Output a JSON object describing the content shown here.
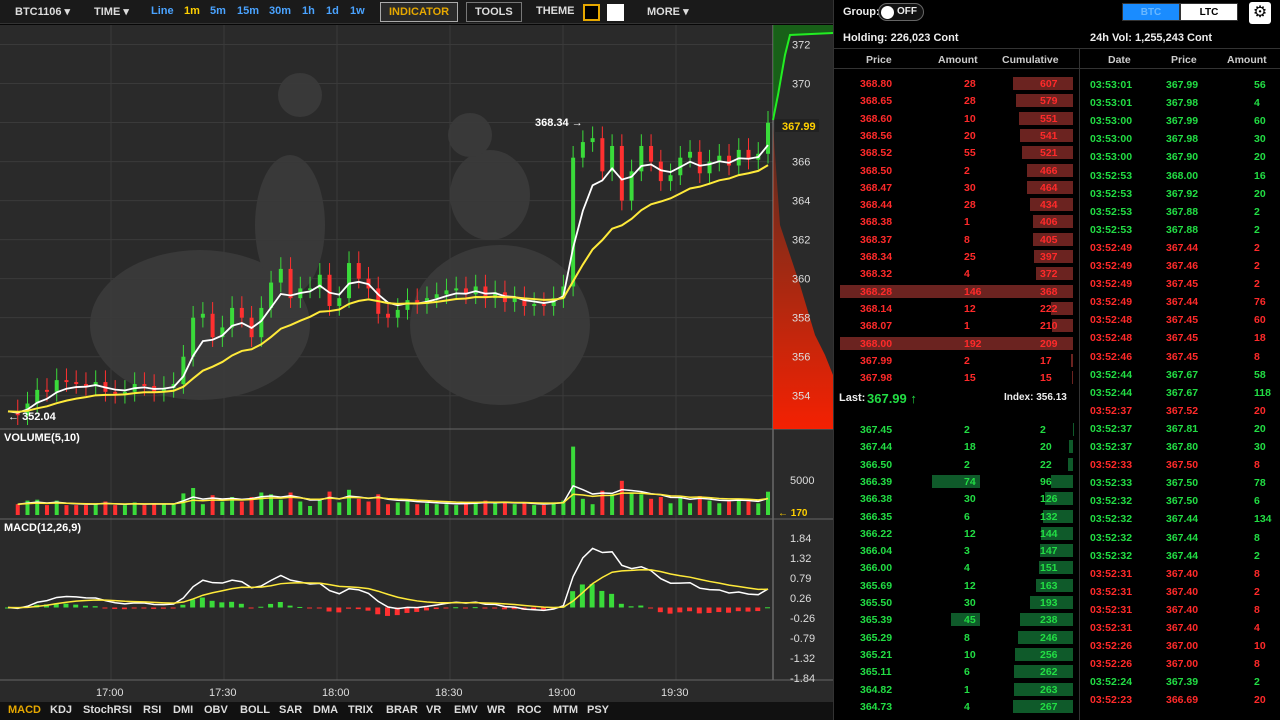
{
  "toolbar": {
    "symbol": "BTC1106",
    "time_label": "TIME",
    "intervals": [
      "Line",
      "1m",
      "5m",
      "15m",
      "30m",
      "1h",
      "1d",
      "1w"
    ],
    "selected_interval": "1m",
    "indicator_label": "INDICATOR",
    "tools_label": "TOOLS",
    "theme_label": "THEME",
    "more_label": "MORE"
  },
  "bottom_indicators": [
    "MACD",
    "KDJ",
    "StochRSI",
    "RSI",
    "DMI",
    "OBV",
    "BOLL",
    "SAR",
    "DMA",
    "TRIX",
    "BRAR",
    "VR",
    "EMV",
    "WR",
    "ROC",
    "MTM",
    "PSY"
  ],
  "selected_indicator": "MACD",
  "chart_data": {
    "type": "line",
    "x_labels": [
      "17:00",
      "17:30",
      "18:00",
      "18:30",
      "19:00",
      "19:30"
    ],
    "price_ticks": [
      "372",
      "370",
      "368",
      "366",
      "364",
      "362",
      "360",
      "358",
      "356",
      "354"
    ],
    "price_range": [
      352.5,
      373
    ],
    "price_series": [
      353.2,
      353.0,
      353.6,
      354.3,
      354.2,
      354.8,
      354.7,
      354.6,
      354.5,
      354.7,
      354.2,
      354.1,
      354.2,
      354.6,
      354.5,
      354.2,
      354.4,
      354.6,
      356.0,
      358.0,
      358.2,
      357.0,
      357.5,
      358.5,
      358.0,
      357.0,
      358.5,
      359.8,
      360.5,
      359.0,
      359.5,
      359.5,
      360.2,
      358.6,
      359.0,
      360.8,
      360.0,
      359.5,
      358.2,
      358.0,
      358.4,
      358.9,
      358.7,
      359.0,
      359.2,
      359.4,
      359.5,
      359.2,
      359.6,
      359.0,
      359.3,
      358.8,
      359.0,
      358.6,
      358.7,
      358.6,
      359.0,
      359.6,
      366.2,
      367.0,
      367.2,
      365.5,
      366.8,
      364.0,
      365.5,
      366.8,
      366.0,
      365.0,
      365.3,
      366.2,
      366.5,
      365.4,
      366.0,
      366.3,
      365.8,
      366.6,
      366.1,
      366.4,
      367.99
    ],
    "annotations": {
      "high": "368.34",
      "low": "352.04",
      "last": "367.99"
    },
    "volume_label": "VOLUME(5,10)",
    "volume_ticks": [
      "5000"
    ],
    "volume_last": "170",
    "macd_label": "MACD(12,26,9)",
    "macd_ticks": [
      "1.84",
      "1.32",
      "0.79",
      "0.26",
      "-0.26",
      "-0.79",
      "-1.32",
      "-1.84"
    ]
  },
  "right_panel": {
    "group_label": "Group:",
    "group_toggle": "OFF",
    "pair_btc": "BTC",
    "pair_ltc": "LTC",
    "holding": "Holding: 226,023 Cont",
    "volume_24h": "24h Vol: 1,255,243 Cont",
    "book_headers": [
      "Price",
      "Amount",
      "Cumulative"
    ],
    "trade_headers": [
      "Date",
      "Price",
      "Amount"
    ],
    "asks": [
      [
        "368.80",
        "28",
        "607"
      ],
      [
        "368.65",
        "28",
        "579"
      ],
      [
        "368.60",
        "10",
        "551"
      ],
      [
        "368.56",
        "20",
        "541"
      ],
      [
        "368.52",
        "55",
        "521"
      ],
      [
        "368.50",
        "2",
        "466"
      ],
      [
        "368.47",
        "30",
        "464"
      ],
      [
        "368.44",
        "28",
        "434"
      ],
      [
        "368.38",
        "1",
        "406"
      ],
      [
        "368.37",
        "8",
        "405"
      ],
      [
        "368.34",
        "25",
        "397"
      ],
      [
        "368.32",
        "4",
        "372"
      ],
      [
        "368.28",
        "146",
        "368"
      ],
      [
        "368.14",
        "12",
        "222"
      ],
      [
        "368.07",
        "1",
        "210"
      ],
      [
        "368.00",
        "192",
        "209"
      ],
      [
        "367.99",
        "2",
        "17"
      ],
      [
        "367.98",
        "15",
        "15"
      ]
    ],
    "last_label": "Last:",
    "last_price": "367.99",
    "index_label": "Index: 356.13",
    "bids": [
      [
        "367.45",
        "2",
        "2"
      ],
      [
        "367.44",
        "18",
        "20"
      ],
      [
        "366.50",
        "2",
        "22"
      ],
      [
        "366.39",
        "74",
        "96"
      ],
      [
        "366.38",
        "30",
        "126"
      ],
      [
        "366.35",
        "6",
        "132"
      ],
      [
        "366.22",
        "12",
        "144"
      ],
      [
        "366.04",
        "3",
        "147"
      ],
      [
        "366.00",
        "4",
        "151"
      ],
      [
        "365.69",
        "12",
        "163"
      ],
      [
        "365.50",
        "30",
        "193"
      ],
      [
        "365.39",
        "45",
        "238"
      ],
      [
        "365.29",
        "8",
        "246"
      ],
      [
        "365.21",
        "10",
        "256"
      ],
      [
        "365.11",
        "6",
        "262"
      ],
      [
        "364.82",
        "1",
        "263"
      ],
      [
        "364.73",
        "4",
        "267"
      ]
    ],
    "trades": [
      [
        "03:53:01",
        "367.99",
        "56",
        "g"
      ],
      [
        "03:53:01",
        "367.98",
        "4",
        "g"
      ],
      [
        "03:53:00",
        "367.99",
        "60",
        "g"
      ],
      [
        "03:53:00",
        "367.98",
        "30",
        "g"
      ],
      [
        "03:53:00",
        "367.90",
        "20",
        "g"
      ],
      [
        "03:52:53",
        "368.00",
        "16",
        "g"
      ],
      [
        "03:52:53",
        "367.92",
        "20",
        "g"
      ],
      [
        "03:52:53",
        "367.88",
        "2",
        "g"
      ],
      [
        "03:52:53",
        "367.88",
        "2",
        "g"
      ],
      [
        "03:52:49",
        "367.44",
        "2",
        "r"
      ],
      [
        "03:52:49",
        "367.46",
        "2",
        "r"
      ],
      [
        "03:52:49",
        "367.45",
        "2",
        "r"
      ],
      [
        "03:52:49",
        "367.44",
        "76",
        "r"
      ],
      [
        "03:52:48",
        "367.45",
        "60",
        "r"
      ],
      [
        "03:52:48",
        "367.45",
        "18",
        "r"
      ],
      [
        "03:52:46",
        "367.45",
        "8",
        "r"
      ],
      [
        "03:52:44",
        "367.67",
        "58",
        "g"
      ],
      [
        "03:52:44",
        "367.67",
        "118",
        "g"
      ],
      [
        "03:52:37",
        "367.52",
        "20",
        "r"
      ],
      [
        "03:52:37",
        "367.81",
        "20",
        "g"
      ],
      [
        "03:52:37",
        "367.80",
        "30",
        "g"
      ],
      [
        "03:52:33",
        "367.50",
        "8",
        "r"
      ],
      [
        "03:52:33",
        "367.50",
        "78",
        "g"
      ],
      [
        "03:52:32",
        "367.50",
        "6",
        "g"
      ],
      [
        "03:52:32",
        "367.44",
        "134",
        "g"
      ],
      [
        "03:52:32",
        "367.44",
        "8",
        "g"
      ],
      [
        "03:52:32",
        "367.44",
        "2",
        "g"
      ],
      [
        "03:52:31",
        "367.40",
        "8",
        "r"
      ],
      [
        "03:52:31",
        "367.40",
        "2",
        "r"
      ],
      [
        "03:52:31",
        "367.40",
        "8",
        "r"
      ],
      [
        "03:52:31",
        "367.40",
        "4",
        "r"
      ],
      [
        "03:52:26",
        "367.00",
        "10",
        "r"
      ],
      [
        "03:52:26",
        "367.00",
        "8",
        "r"
      ],
      [
        "03:52:24",
        "367.39",
        "2",
        "g"
      ],
      [
        "03:52:23",
        "366.69",
        "20",
        "r"
      ]
    ]
  }
}
